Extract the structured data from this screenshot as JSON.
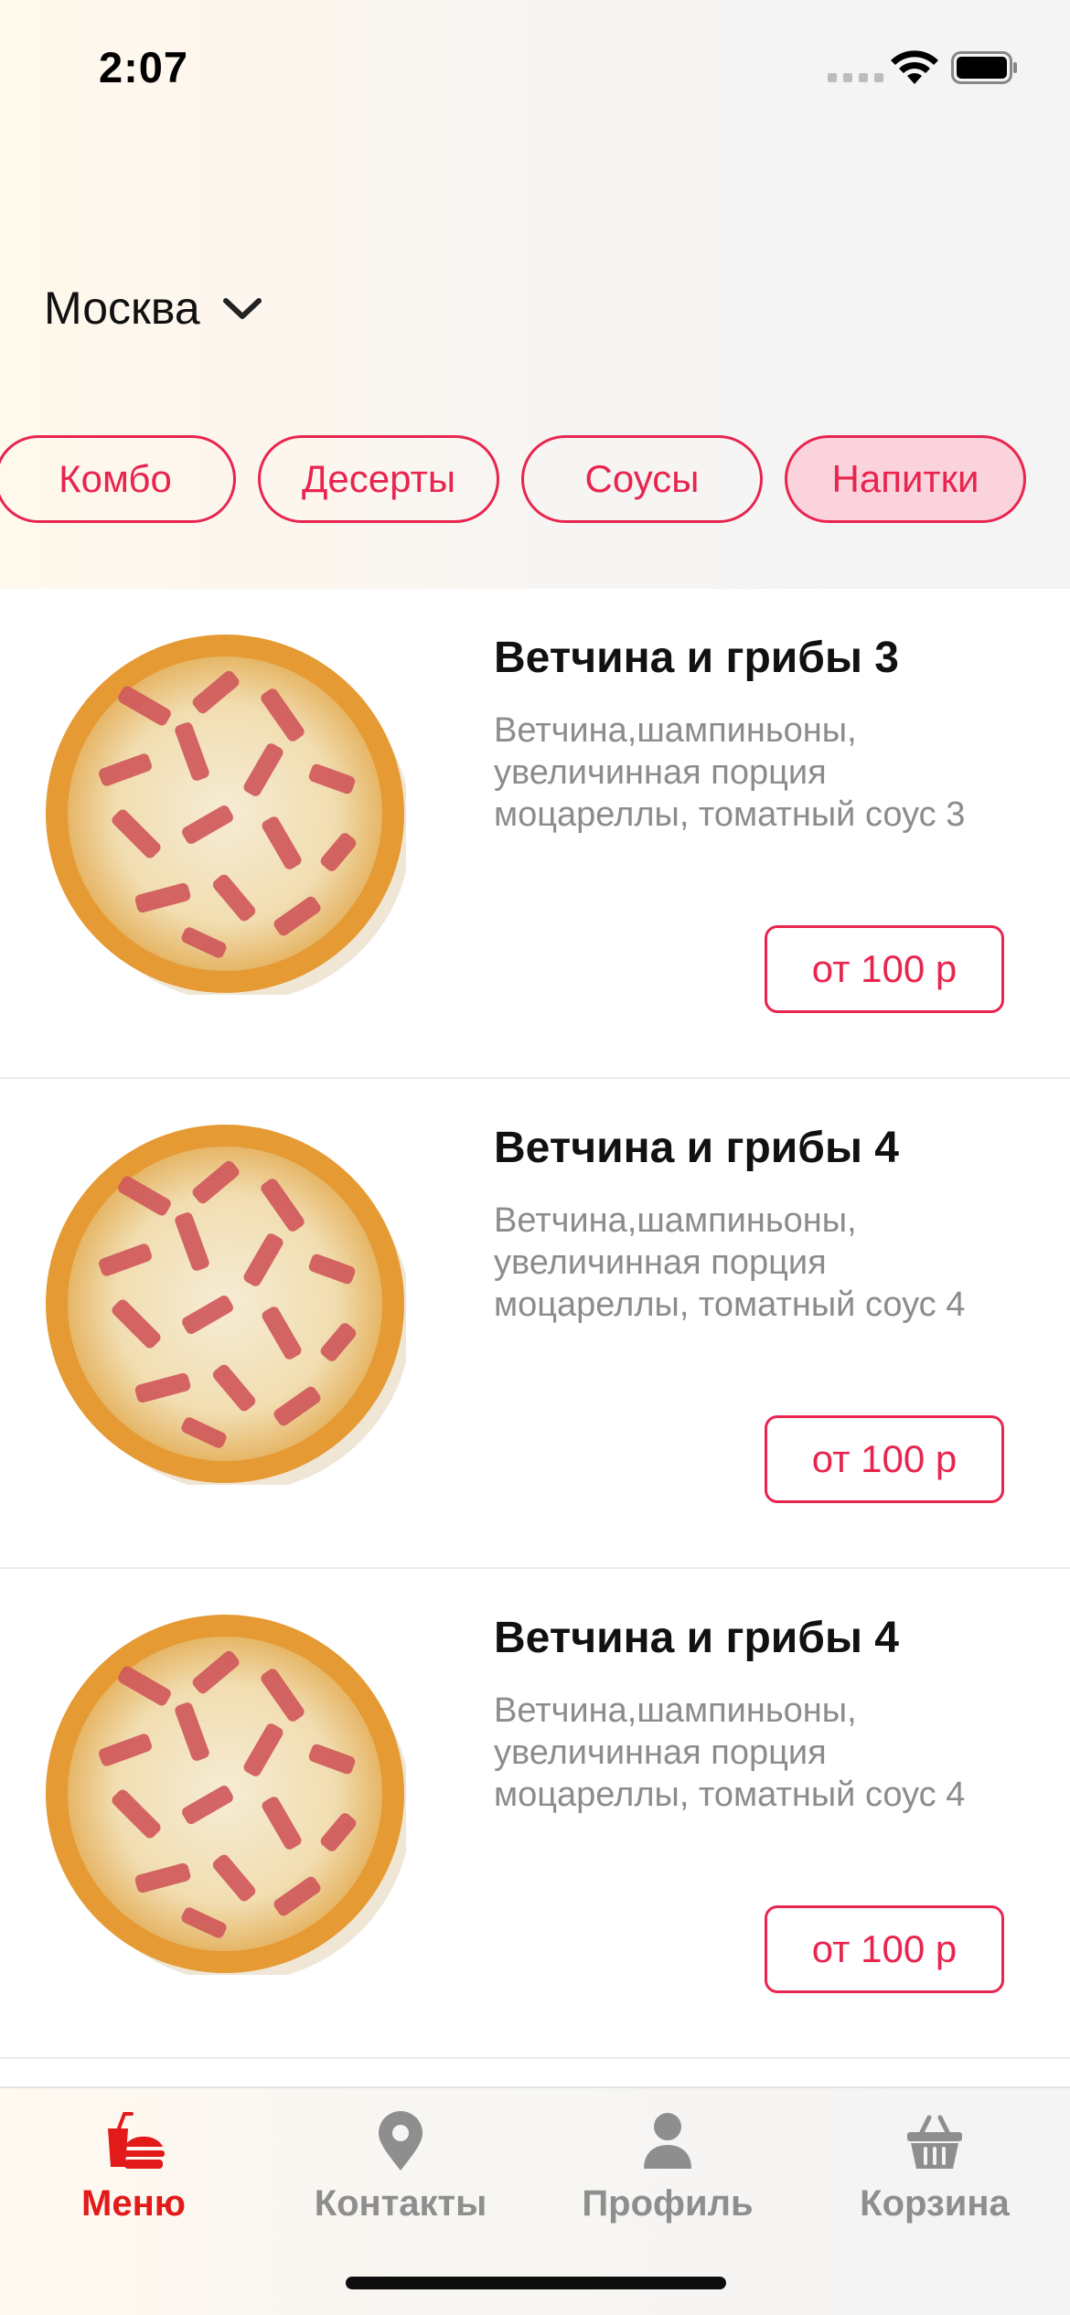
{
  "status_bar": {
    "time": "2:07"
  },
  "city": {
    "name": "Москва"
  },
  "categories": [
    {
      "label": "Комбо",
      "active": false
    },
    {
      "label": "Десерты",
      "active": false
    },
    {
      "label": "Соусы",
      "active": false
    },
    {
      "label": "Напитки",
      "active": true
    }
  ],
  "products": [
    {
      "title": "Ветчина и грибы 3",
      "description": "Ветчина,шампиньоны, увеличинная порция моцареллы, томатный соус 3",
      "price": "от 100 р"
    },
    {
      "title": "Ветчина и грибы 4",
      "description": "Ветчина,шампиньоны, увеличинная порция моцареллы, томатный соус 4",
      "price": "от 100 р"
    },
    {
      "title": "Ветчина и грибы 4",
      "description": "Ветчина,шампиньоны, увеличинная порция моцареллы, томатный соус 4",
      "price": "от 100 р"
    }
  ],
  "tabs": [
    {
      "label": "Меню",
      "icon": "burger-drink-icon",
      "active": true
    },
    {
      "label": "Контакты",
      "icon": "location-pin-icon",
      "active": false
    },
    {
      "label": "Профиль",
      "icon": "person-icon",
      "active": false
    },
    {
      "label": "Корзина",
      "icon": "basket-icon",
      "active": false
    }
  ],
  "colors": {
    "accent": "#e8254f",
    "active_tab": "#e21a1a",
    "inactive_tab": "#8e8e8e",
    "pill_active_bg": "#fbd3dc"
  }
}
